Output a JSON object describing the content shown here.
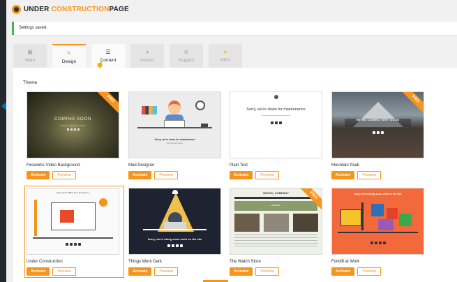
{
  "app": {
    "logo_left": "UNDER",
    "logo_mid": "CONSTRUCTION",
    "logo_right": "PAGE"
  },
  "notice": {
    "text": "Settings saved."
  },
  "tabs": [
    {
      "label": "Main",
      "icon": "dashboard-icon",
      "active": false
    },
    {
      "label": "Design",
      "icon": "brush-icon",
      "active": true
    },
    {
      "label": "Content",
      "icon": "content-icon",
      "active": false,
      "hover": true
    },
    {
      "label": "Access",
      "icon": "access-icon",
      "active": false
    },
    {
      "label": "Support",
      "icon": "support-icon",
      "active": false
    },
    {
      "label": "PRO",
      "icon": "star-icon",
      "active": false
    }
  ],
  "theme_section": {
    "label": "Theme"
  },
  "themes": [
    {
      "name": "Fireworks Video Background",
      "pro": true,
      "thumb_text": "COMING SOON",
      "thumb_sub": "WE WILL BE BACK SOON",
      "activate": "Activate",
      "preview": "Preview"
    },
    {
      "name": "Mad Designer",
      "pro": false,
      "thumb_text": "Sorry, we're down for maintenance",
      "thumb_sub": "We'll be back shortly",
      "activate": "Activate",
      "preview": "Preview"
    },
    {
      "name": "Plain Text",
      "pro": false,
      "thumb_text": "Sorry, we're down for maintenance",
      "activate": "Activate",
      "preview": "Preview"
    },
    {
      "name": "Mountain Peak",
      "pro": true,
      "thumb_text": "WE'RE COMING VERY SOON",
      "activate": "Activate",
      "preview": "Preview"
    },
    {
      "name": "Under Construction",
      "pro": false,
      "selected": true,
      "thumb_text": "Sorry, we're offline for a few hours :(",
      "activate": "Activate",
      "preview": "Preview"
    },
    {
      "name": "Things Went Dark",
      "pro": false,
      "thumb_text": "Sorry, we're doing some work on the site",
      "activate": "Activate",
      "preview": "Preview"
    },
    {
      "name": "The Watch Store",
      "pro": true,
      "thumb_text": "WATCH_COMPANY",
      "thumb_sub": "Collection",
      "activate": "Activate",
      "preview": "Preview"
    },
    {
      "name": "Forklift at Work",
      "pro": false,
      "thumb_text": "Sorry, we're doing some work on the site",
      "activate": "Activate",
      "preview": "Preview"
    }
  ],
  "badge": {
    "pro_label": "PRO"
  },
  "colors": {
    "accent": "#f7941d",
    "success": "#46b450",
    "admin_bar": "#23282d"
  }
}
